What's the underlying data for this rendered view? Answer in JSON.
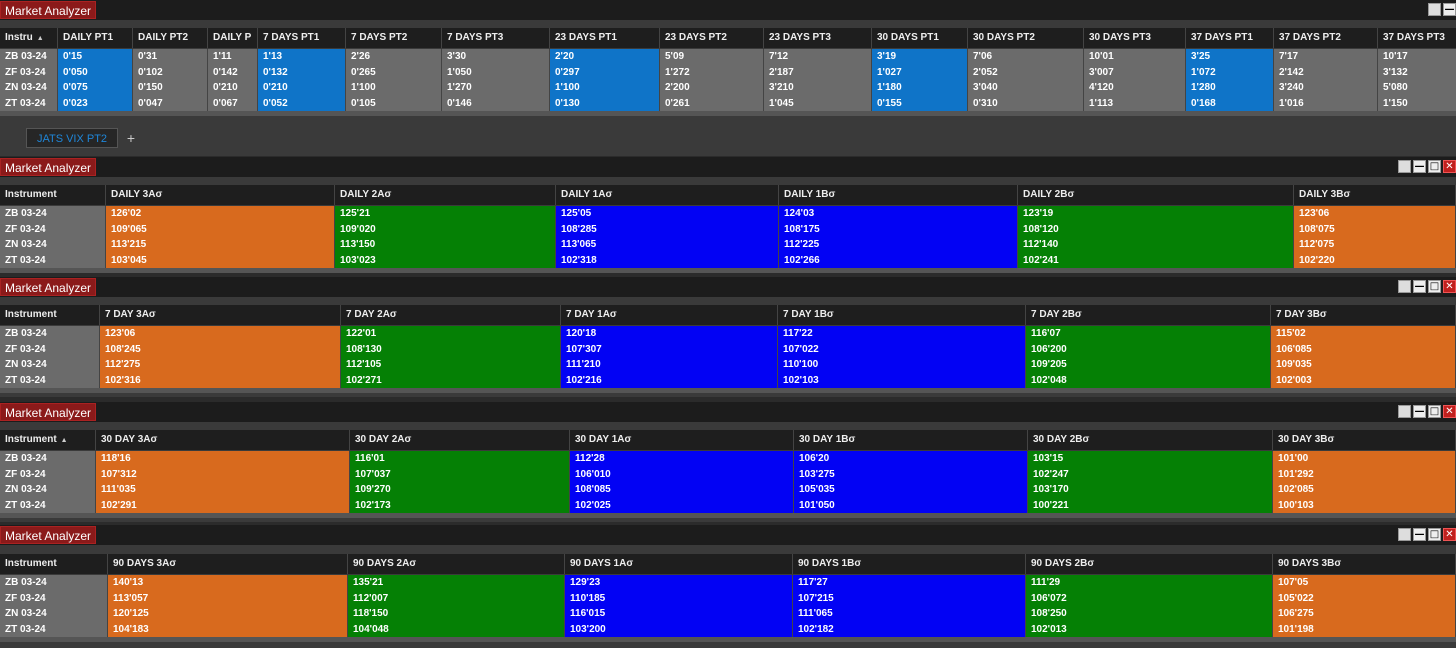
{
  "app_title": "Market Analyzer",
  "instruments": [
    "ZB 03-24",
    "ZF 03-24",
    "ZN 03-24",
    "ZT 03-24"
  ],
  "sort_arrow": "▲",
  "window_buttons": {
    "restore": "",
    "minimize": "—",
    "maximize": "□",
    "close": "✕"
  },
  "tab": {
    "label": "JATS VIX PT2",
    "add": "+"
  },
  "panel1": {
    "instrument_header": "Instru",
    "columns": [
      {
        "header": "DAILY PT1",
        "values": [
          "0'15",
          "0'050",
          "0'075",
          "0'023"
        ],
        "color": "blue"
      },
      {
        "header": "DAILY PT2",
        "values": [
          "0'31",
          "0'102",
          "0'150",
          "0'047"
        ],
        "color": "gray"
      },
      {
        "header": "DAILY P",
        "values": [
          "1'11",
          "0'142",
          "0'210",
          "0'067"
        ],
        "color": "gray"
      },
      {
        "header": "7 DAYS PT1",
        "values": [
          "1'13",
          "0'132",
          "0'210",
          "0'052"
        ],
        "color": "blue"
      },
      {
        "header": "7 DAYS PT2",
        "values": [
          "2'26",
          "0'265",
          "1'100",
          "0'105"
        ],
        "color": "gray"
      },
      {
        "header": "7 DAYS PT3",
        "values": [
          "3'30",
          "1'050",
          "1'270",
          "0'146"
        ],
        "color": "gray"
      },
      {
        "header": "23 DAYS PT1",
        "values": [
          "2'20",
          "0'297",
          "1'100",
          "0'130"
        ],
        "color": "blue"
      },
      {
        "header": "23 DAYS PT2",
        "values": [
          "5'09",
          "1'272",
          "2'200",
          "0'261"
        ],
        "color": "gray"
      },
      {
        "header": "23 DAYS PT3",
        "values": [
          "7'12",
          "2'187",
          "3'210",
          "1'045"
        ],
        "color": "gray"
      },
      {
        "header": "30 DAYS PT1",
        "values": [
          "3'19",
          "1'027",
          "1'180",
          "0'155"
        ],
        "color": "blue"
      },
      {
        "header": "30 DAYS PT2",
        "values": [
          "7'06",
          "2'052",
          "3'040",
          "0'310"
        ],
        "color": "gray"
      },
      {
        "header": "30 DAYS PT3",
        "values": [
          "10'01",
          "3'007",
          "4'120",
          "1'113"
        ],
        "color": "gray"
      },
      {
        "header": "37 DAYS PT1",
        "values": [
          "3'25",
          "1'072",
          "1'280",
          "0'168"
        ],
        "color": "blue"
      },
      {
        "header": "37 DAYS PT2",
        "values": [
          "7'17",
          "2'142",
          "3'240",
          "1'016"
        ],
        "color": "gray"
      },
      {
        "header": "37 DAYS PT3",
        "values": [
          "10'17",
          "3'132",
          "5'080",
          "1'150"
        ],
        "color": "gray"
      }
    ]
  },
  "panel2": {
    "instrument_header": "Instrument",
    "columns": [
      {
        "header": "DAILY 3Aσ",
        "values": [
          "126'02",
          "109'065",
          "113'215",
          "103'045"
        ],
        "color": "orange"
      },
      {
        "header": "DAILY 2Aσ",
        "values": [
          "125'21",
          "109'020",
          "113'150",
          "103'023"
        ],
        "color": "green"
      },
      {
        "header": "DAILY 1Aσ",
        "values": [
          "125'05",
          "108'285",
          "113'065",
          "102'318"
        ],
        "color": "bblue"
      },
      {
        "header": "DAILY 1Bσ",
        "values": [
          "124'03",
          "108'175",
          "112'225",
          "102'266"
        ],
        "color": "bblue"
      },
      {
        "header": "DAILY 2Bσ",
        "values": [
          "123'19",
          "108'120",
          "112'140",
          "102'241"
        ],
        "color": "green"
      },
      {
        "header": "DAILY 3Bσ",
        "values": [
          "123'06",
          "108'075",
          "112'075",
          "102'220"
        ],
        "color": "orange"
      }
    ]
  },
  "panel3": {
    "instrument_header": "Instrument",
    "columns": [
      {
        "header": "7 DAY 3Aσ",
        "values": [
          "123'06",
          "108'245",
          "112'275",
          "102'316"
        ],
        "color": "orange"
      },
      {
        "header": "7 DAY 2Aσ",
        "values": [
          "122'01",
          "108'130",
          "112'105",
          "102'271"
        ],
        "color": "green"
      },
      {
        "header": "7 DAY 1Aσ",
        "values": [
          "120'18",
          "107'307",
          "111'210",
          "102'216"
        ],
        "color": "bblue"
      },
      {
        "header": "7 DAY 1Bσ",
        "values": [
          "117'22",
          "107'022",
          "110'100",
          "102'103"
        ],
        "color": "bblue"
      },
      {
        "header": "7 DAY 2Bσ",
        "values": [
          "116'07",
          "106'200",
          "109'205",
          "102'048"
        ],
        "color": "green"
      },
      {
        "header": "7 DAY 3Bσ",
        "values": [
          "115'02",
          "106'085",
          "109'035",
          "102'003"
        ],
        "color": "orange"
      }
    ]
  },
  "panel4": {
    "instrument_header": "Instrument",
    "columns": [
      {
        "header": "30 DAY 3Aσ",
        "values": [
          "118'16",
          "107'312",
          "111'035",
          "102'291"
        ],
        "color": "orange"
      },
      {
        "header": "30 DAY 2Aσ",
        "values": [
          "116'01",
          "107'037",
          "109'270",
          "102'173"
        ],
        "color": "green"
      },
      {
        "header": "30 DAY 1Aσ",
        "values": [
          "112'28",
          "106'010",
          "108'085",
          "102'025"
        ],
        "color": "bblue"
      },
      {
        "header": "30 DAY 1Bσ",
        "values": [
          "106'20",
          "103'275",
          "105'035",
          "101'050"
        ],
        "color": "bblue"
      },
      {
        "header": "30 DAY 2Bσ",
        "values": [
          "103'15",
          "102'247",
          "103'170",
          "100'221"
        ],
        "color": "green"
      },
      {
        "header": "30 DAY 3Bσ",
        "values": [
          "101'00",
          "101'292",
          "102'085",
          "100'103"
        ],
        "color": "orange"
      }
    ]
  },
  "panel5": {
    "instrument_header": "Instrument",
    "columns": [
      {
        "header": "90 DAYS 3Aσ",
        "values": [
          "140'13",
          "113'057",
          "120'125",
          "104'183"
        ],
        "color": "orange"
      },
      {
        "header": "90 DAYS 2Aσ",
        "values": [
          "135'21",
          "112'007",
          "118'150",
          "104'048"
        ],
        "color": "green"
      },
      {
        "header": "90 DAYS 1Aσ",
        "values": [
          "129'23",
          "110'185",
          "116'015",
          "103'200"
        ],
        "color": "bblue"
      },
      {
        "header": "90 DAYS 1Bσ",
        "values": [
          "117'27",
          "107'215",
          "111'065",
          "102'182"
        ],
        "color": "bblue"
      },
      {
        "header": "90 DAYS 2Bσ",
        "values": [
          "111'29",
          "106'072",
          "108'250",
          "102'013"
        ],
        "color": "green"
      },
      {
        "header": "90 DAYS 3Bσ",
        "values": [
          "107'05",
          "105'022",
          "106'275",
          "101'198"
        ],
        "color": "orange"
      }
    ]
  }
}
